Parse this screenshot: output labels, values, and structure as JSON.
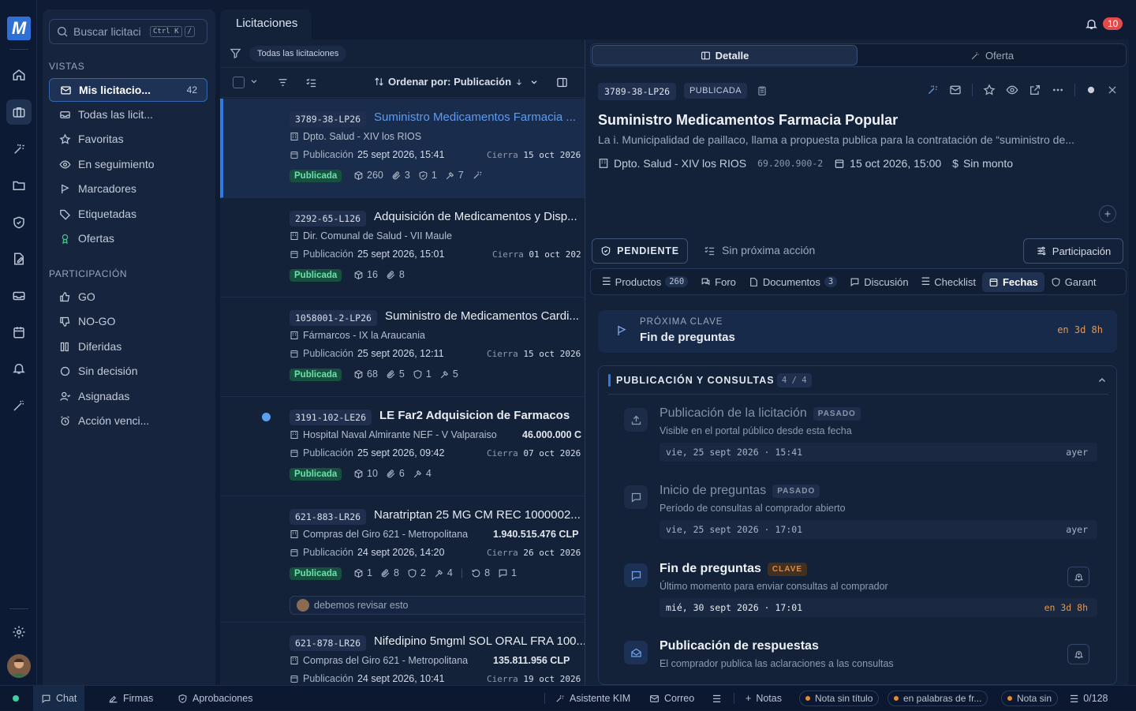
{
  "app": {
    "logo": "M",
    "notifications": "10"
  },
  "sidebar": {
    "search_placeholder": "Buscar licitaci",
    "kbd1": "Ctrl K",
    "kbd2": "/",
    "vistas_title": "VISTAS",
    "vistas": [
      {
        "label": "Mis licitacio...",
        "count": "42"
      },
      {
        "label": "Todas las licit..."
      },
      {
        "label": "Favoritas"
      },
      {
        "label": "En seguimiento"
      },
      {
        "label": "Marcadores"
      },
      {
        "label": "Etiquetadas"
      },
      {
        "label": "Ofertas"
      }
    ],
    "particip_title": "PARTICIPACIÓN",
    "particip": [
      {
        "label": "GO"
      },
      {
        "label": "NO-GO"
      },
      {
        "label": "Diferidas"
      },
      {
        "label": "Sin decisión"
      },
      {
        "label": "Asignadas"
      },
      {
        "label": "Acción venci..."
      }
    ]
  },
  "list": {
    "tab": "Licitaciones",
    "filter_chip": "Todas las licitaciones",
    "sort_label": "Ordenar por: Publicación",
    "items": [
      {
        "code": "3789-38-LP26",
        "title": "Suministro Medicamentos Farmacia ...",
        "org": "Dpto. Salud - XIV los RIOS",
        "amount": "",
        "pub_label": "Publicación",
        "pub": "25 sept 2026, 15:41",
        "close_label": "Cierra",
        "close": "15 oct 2026",
        "status": "Publicada",
        "stats": [
          "260",
          "3",
          "1",
          "7",
          ""
        ]
      },
      {
        "code": "2292-65-L126",
        "title": "Adquisición de Medicamentos y Disp...",
        "org": "Dir. Comunal de Salud - VII Maule",
        "amount": "",
        "pub_label": "Publicación",
        "pub": "25 sept 2026, 15:01",
        "close_label": "Cierra",
        "close": "01 oct 202",
        "status": "Publicada",
        "stats": [
          "16",
          "8"
        ]
      },
      {
        "code": "1058001-2-LP26",
        "title": "Suministro de Medicamentos Cardi...",
        "org": "Fármarcos - IX la Araucania",
        "amount": "",
        "pub_label": "Publicación",
        "pub": "25 sept 2026, 12:11",
        "close_label": "Cierra",
        "close": "15 oct 2026",
        "status": "Publicada",
        "stats": [
          "68",
          "5",
          "1",
          "5"
        ]
      },
      {
        "code": "3191-102-LE26",
        "title": "LE Far2 Adquisicion de Farmacos",
        "org": "Hospital Naval Almirante NEF - V Valparaiso",
        "amount": "46.000.000 C",
        "pub_label": "Publicación",
        "pub": "25 sept 2026, 09:42",
        "close_label": "Cierra",
        "close": "07 oct 2026",
        "status": "Publicada",
        "stats": [
          "10",
          "6",
          "4"
        ]
      },
      {
        "code": "621-883-LR26",
        "title": "Naratriptan 25 MG CM REC 1000002...",
        "org": "Compras del Giro 621 - Metropolitana",
        "amount": "1.940.515.476 CLP",
        "pub_label": "Publicación",
        "pub": "24 sept 2026, 14:20",
        "close_label": "Cierra",
        "close": "26 oct 2026",
        "status": "Publicada",
        "stats": [
          "1",
          "8",
          "2",
          "4",
          "8",
          "1"
        ],
        "note": "debemos revisar esto"
      },
      {
        "code": "621-878-LR26",
        "title": "Nifedipino 5mgml SOL ORAL FRA 100...",
        "org": "Compras del Giro 621 - Metropolitana",
        "amount": "135.811.956 CLP",
        "pub_label": "Publicación",
        "pub": "24 sept 2026, 10:41",
        "close_label": "Cierra",
        "close": "19 oct 2026"
      }
    ]
  },
  "detail": {
    "tab_detail": "Detalle",
    "tab_offer": "Oferta",
    "code": "3789-38-LP26",
    "status": "PUBLICADA",
    "title": "Suministro Medicamentos Farmacia Popular",
    "description": "La i. Municipalidad de paillaco, llama a propuesta publica para la contratación de “suministro de...",
    "org": "Dpto. Salud - XIV los RIOS",
    "rut": "69.200.900-2",
    "date": "15 oct 2026, 15:00",
    "amount": "Sin monto",
    "pending": "PENDIENTE",
    "next_action": "Sin próxima acción",
    "participation": "Participación",
    "tabs": [
      {
        "label": "Productos",
        "n": "260"
      },
      {
        "label": "Foro"
      },
      {
        "label": "Documentos",
        "n": "3"
      },
      {
        "label": "Discusión"
      },
      {
        "label": "Checklist"
      },
      {
        "label": "Fechas"
      },
      {
        "label": "Garant"
      }
    ],
    "next_key_label": "PRÓXIMA CLAVE",
    "next_key": "Fin de preguntas",
    "next_key_when": "en 3d 8h",
    "group_title": "PUBLICACIÓN Y CONSULTAS",
    "group_count": "4 / 4",
    "events": [
      {
        "title": "Publicación de la licitación",
        "tag": "PASADO",
        "desc": "Visible en el portal público desde esta fecha",
        "dt": "vie, 25 sept 2026 · 15:41",
        "rel": "ayer"
      },
      {
        "title": "Inicio de preguntas",
        "tag": "PASADO",
        "desc": "Período de consultas al comprador abierto",
        "dt": "vie, 25 sept 2026 · 17:01",
        "rel": "ayer"
      },
      {
        "title": "Fin de preguntas",
        "tag": "CLAVE",
        "desc": "Último momento para enviar consultas al comprador",
        "dt": "mié, 30 sept 2026 · 17:01",
        "rel": "en 3d 8h"
      },
      {
        "title": "Publicación de respuestas",
        "desc": "El comprador publica las aclaraciones a las consultas"
      }
    ]
  },
  "statusbar": {
    "chat": "Chat",
    "firmas": "Firmas",
    "aprob": "Aprobaciones",
    "kim": "Asistente KIM",
    "correo": "Correo",
    "notas": "Notas",
    "nota1": "Nota sin título",
    "nota2": "en palabras de fr...",
    "nota3": "Nota sin",
    "count": "0/128"
  }
}
